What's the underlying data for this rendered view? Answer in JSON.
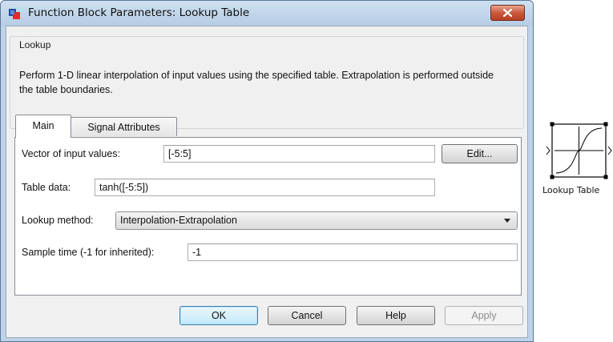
{
  "dialog": {
    "title": "Function Block Parameters: Lookup Table",
    "close_icon": "close-icon",
    "app_icon": "simulink-block-icon"
  },
  "description_group": {
    "label": "Lookup",
    "text": "Perform 1-D linear interpolation of input values using the specified table.  Extrapolation is performed outside the table boundaries."
  },
  "tabs": [
    {
      "label": "Main",
      "active": true
    },
    {
      "label": "Signal Attributes",
      "active": false
    }
  ],
  "main": {
    "input_values": {
      "label": "Vector of input values:",
      "value": "[-5:5]",
      "edit_button": "Edit..."
    },
    "table_data": {
      "label": "Table data:",
      "value": "tanh([-5:5])"
    },
    "lookup_method": {
      "label": "Lookup method:",
      "selected": "Interpolation-Extrapolation"
    },
    "sample_time": {
      "label": "Sample time (-1 for inherited):",
      "value": "-1"
    }
  },
  "buttons": {
    "ok": "OK",
    "cancel": "Cancel",
    "help": "Help",
    "apply": "Apply"
  },
  "block": {
    "label": "Lookup Table",
    "icon": "lookup-table-block-icon"
  },
  "colors": {
    "titlebar": "#bcd3e8",
    "close_button": "#c85a3f",
    "ok_border": "#3c7fb1"
  }
}
